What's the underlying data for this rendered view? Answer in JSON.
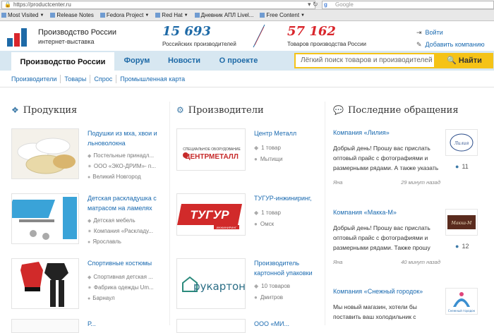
{
  "browser": {
    "url": "https://productcenter.ru",
    "search_placeholder": "Google",
    "bookmarks": [
      {
        "label": "Most Visited",
        "dropdown": true
      },
      {
        "label": "Release Notes",
        "dropdown": false
      },
      {
        "label": "Fedora Project",
        "dropdown": true
      },
      {
        "label": "Red Hat",
        "dropdown": true
      },
      {
        "label": "Дневник АПЛ Livel...",
        "dropdown": false
      },
      {
        "label": "Free Content",
        "dropdown": true
      }
    ]
  },
  "header": {
    "brand_title": "Производство России",
    "brand_subtitle": "интернет-выставка",
    "producers_count": "15 693",
    "producers_label": "Российских производителей",
    "goods_count": "57 162",
    "goods_label": "Товаров производства России",
    "login": "Войти",
    "add_company": "Добавить компанию",
    "colors": {
      "blue": "#1e6aa7",
      "red": "#d9262c",
      "accent": "#f5c317"
    }
  },
  "nav": {
    "tabs": [
      "Производство России",
      "Форум",
      "Новости",
      "О проекте"
    ],
    "search_placeholder": "Лёгкий поиск товаров и производителей",
    "search_button": "Найти"
  },
  "subnav": [
    "Производители",
    "Товары",
    "Спрос",
    "Промышленная карта"
  ],
  "products": {
    "title": "Продукция",
    "icon": "cubes-icon",
    "items": [
      {
        "title": "Подушки из мха, хвои и льноволокна",
        "category": "Постельные принадл...",
        "company": "ООО «ЭКО-ДРИМ»- п...",
        "city": "Великий Новгород"
      },
      {
        "title": "Детская раскладушка с матрасом на ламелях",
        "category": "Детская мебель",
        "company": "Компания «Раскладу...",
        "city": "Ярославль"
      },
      {
        "title": "Спортивные костюмы",
        "category": "Спортивная детская ...",
        "company": "Фабрика одежды Um...",
        "city": "Барнаул"
      },
      {
        "title": "Р...",
        "category": "",
        "company": "",
        "city": ""
      }
    ]
  },
  "manufacturers": {
    "title": "Производители",
    "icon": "gear-icon",
    "items": [
      {
        "name": "Центр Металл",
        "goods": "1 товар",
        "city": "Мытищи",
        "logo": "ЦЕНТРМЕТАЛЛ",
        "logo_caption": "СПЕЦИАЛЬНОЕ ОБОРУДОВАНИЕ"
      },
      {
        "name": "ТУГУР-инжиниринг,",
        "goods": "1 товар",
        "city": "Омск",
        "logo": "ТУГУР",
        "logo_caption": "ИНЖИНИРИНГ"
      },
      {
        "name": "Производитель картонной упаковки",
        "goods": "10 товаров",
        "city": "Дмитров",
        "logo": "рукартон",
        "logo_caption": ""
      },
      {
        "name": "ООО «МИ...",
        "goods": "",
        "city": "",
        "logo": "",
        "logo_caption": ""
      }
    ]
  },
  "requests": {
    "title": "Последние обращения",
    "icon": "comments-icon",
    "items": [
      {
        "company": "Компания «Лилия»",
        "text": "Добрый день! Прошу вас прислать оптовый прайс с фотографиями и размерными рядами. А также указать",
        "author": "Яна",
        "time": "29 минут назад",
        "count": "11",
        "avatar": "Лилия"
      },
      {
        "company": "Компания «Макка-М»",
        "text": "Добрый день! Прошу вас прислать оптовый прайс с фотографиями и размерными рядами. Также прошу",
        "author": "Яна",
        "time": "40 минут назад",
        "count": "12",
        "avatar": "Макка-М"
      },
      {
        "company": "Компания «Снежный городок»",
        "text": "Мы новый магазин, хотели бы поставить ваш холодильник с мороженым",
        "author": "",
        "time": "",
        "count": "",
        "avatar": "Снежный городок"
      }
    ]
  }
}
